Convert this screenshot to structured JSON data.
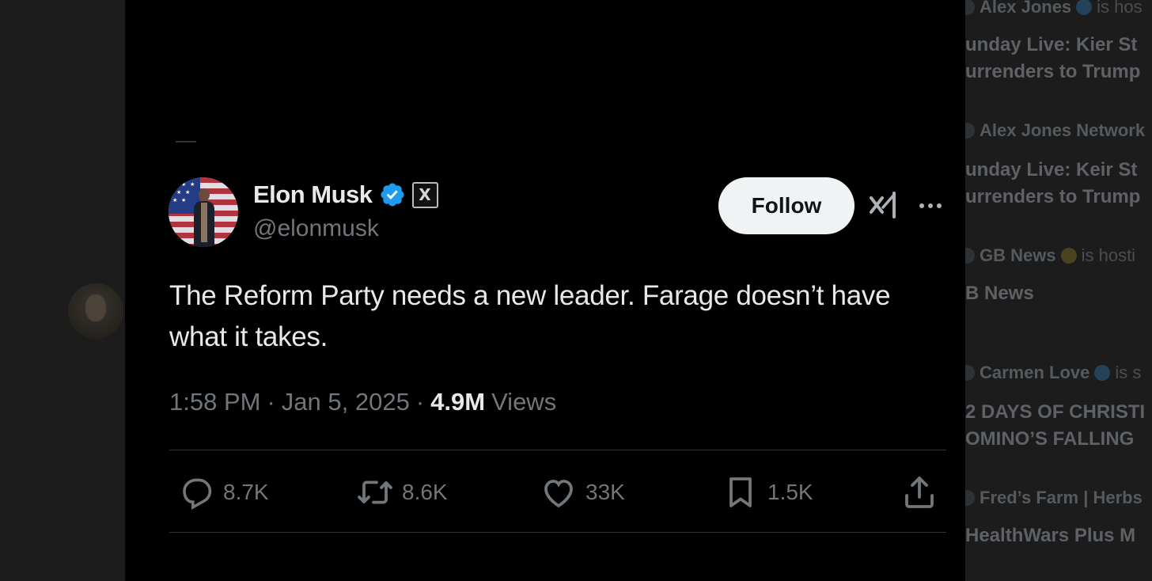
{
  "tweet": {
    "author_name": "Elon Musk",
    "handle": "@elonmusk",
    "affiliate_badge": "X",
    "follow_label": "Follow",
    "text": "The Reform Party needs a new leader. Farage doesn’t have what it takes.",
    "time": "1:58 PM",
    "date": "Jan 5, 2025",
    "separator": "·",
    "views_count": "4.9M",
    "views_label": "Views",
    "stats": {
      "replies": "8.7K",
      "reposts": "8.6K",
      "likes": "33K",
      "bookmarks": "1.5K"
    }
  },
  "sidebar": {
    "items": [
      {
        "host": "Alex Jones",
        "suffix": "is hos",
        "title_1": "unday Live: Kier St",
        "title_2": "urrenders to Trump"
      },
      {
        "host": "Alex Jones Network",
        "suffix": "",
        "title_1": "unday Live: Keir St",
        "title_2": "urrenders to Trump"
      },
      {
        "host": "GB News",
        "suffix": "is hosti",
        "title_1": "B News",
        "title_2": ""
      },
      {
        "host": "Carmen Love",
        "suffix": "is s",
        "title_1": "2 DAYS OF CHRISTI",
        "title_2": "OMINO’S FALLING"
      },
      {
        "host": "Fred’s Farm | Herbs",
        "suffix": "",
        "title_1": "HealthWars Plus M",
        "title_2": ""
      }
    ]
  },
  "colors": {
    "background": "#000000",
    "text_primary": "#e7e9ea",
    "text_secondary": "#71767b",
    "verified_blue": "#1d9bf0",
    "follow_button_bg": "#eff3f4",
    "divider": "#2f3336"
  },
  "icons": [
    "verified-badge-icon",
    "x-affiliate-icon",
    "grok-icon",
    "more-icon",
    "reply-icon",
    "repost-icon",
    "like-icon",
    "bookmark-icon",
    "share-icon"
  ]
}
